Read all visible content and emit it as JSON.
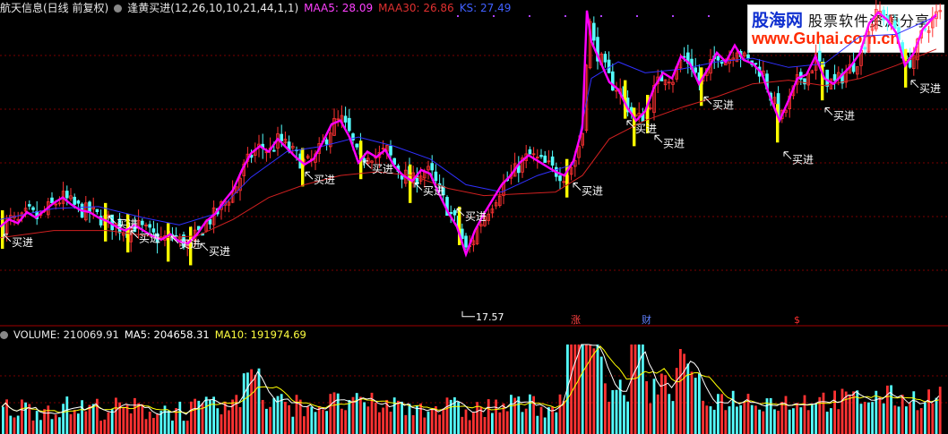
{
  "header": {
    "title": "航天信息(日线 前复权)",
    "indicator": "逢黄买进(12,26,10,10,21,44,1,1)",
    "maa5_label": "MAA5: 28.09",
    "maa30_label": "MAA30: 26.86",
    "ks_label": "KS: 27.49"
  },
  "volume_header": {
    "volume": "VOLUME: 210069.91",
    "ma5": "MA5: 204658.31",
    "ma10": "MA10: 191974.69"
  },
  "logo": {
    "brand": "股海网",
    "tagline": "股票软件资源分享",
    "url": "www.Guhai.com.cn"
  },
  "chart_data": {
    "type": "candlestick",
    "title": "航天信息(日线 前复权)",
    "low_marker": "17.57",
    "signal_label": "买进",
    "event_labels": [
      "涨",
      "财",
      "$"
    ],
    "y_range": [
      16.5,
      33.2
    ],
    "colors": {
      "up": "#ff3232",
      "down": "#54ffff",
      "yellow_bar": "#ffff00",
      "maa5": "#ff00ff",
      "maa30": "#d02020",
      "ks": "#3030ff",
      "signal_text": "#ffffff",
      "volume_ma5": "#ffffff",
      "volume_ma10": "#ffff00",
      "grid": "#7a0000"
    },
    "price_path": [
      [
        0,
        21.8
      ],
      [
        10,
        22.2
      ],
      [
        20,
        22.0
      ],
      [
        30,
        22.6
      ],
      [
        40,
        22.3
      ],
      [
        50,
        22.7
      ],
      [
        60,
        23.1
      ],
      [
        70,
        23.4
      ],
      [
        80,
        23.0
      ],
      [
        90,
        22.7
      ],
      [
        100,
        22.6
      ],
      [
        110,
        22.3
      ],
      [
        120,
        22.1
      ],
      [
        130,
        21.8
      ],
      [
        140,
        21.6
      ],
      [
        150,
        21.9
      ],
      [
        160,
        21.6
      ],
      [
        170,
        21.3
      ],
      [
        180,
        21.1
      ],
      [
        190,
        21.4
      ],
      [
        200,
        21.0
      ],
      [
        210,
        20.9
      ],
      [
        220,
        21.4
      ],
      [
        230,
        22.1
      ],
      [
        240,
        22.5
      ],
      [
        250,
        23.2
      ],
      [
        260,
        23.8
      ],
      [
        270,
        24.9
      ],
      [
        280,
        25.8
      ],
      [
        290,
        26.2
      ],
      [
        300,
        25.9
      ],
      [
        310,
        26.6
      ],
      [
        320,
        26.1
      ],
      [
        330,
        25.6
      ],
      [
        340,
        25.2
      ],
      [
        350,
        25.5
      ],
      [
        360,
        26.4
      ],
      [
        370,
        27.4
      ],
      [
        380,
        27.6
      ],
      [
        390,
        26.7
      ],
      [
        400,
        25.3
      ],
      [
        410,
        25.9
      ],
      [
        420,
        25.6
      ],
      [
        430,
        26.0
      ],
      [
        440,
        25.1
      ],
      [
        450,
        24.6
      ],
      [
        460,
        24.3
      ],
      [
        470,
        24.9
      ],
      [
        480,
        24.7
      ],
      [
        490,
        23.6
      ],
      [
        500,
        22.6
      ],
      [
        510,
        21.8
      ],
      [
        520,
        20.3
      ],
      [
        530,
        21.6
      ],
      [
        540,
        22.5
      ],
      [
        550,
        23.3
      ],
      [
        560,
        24.1
      ],
      [
        570,
        24.6
      ],
      [
        580,
        25.3
      ],
      [
        590,
        25.7
      ],
      [
        600,
        25.4
      ],
      [
        610,
        25.1
      ],
      [
        620,
        24.8
      ],
      [
        630,
        24.6
      ],
      [
        640,
        25.4
      ],
      [
        650,
        27.2
      ],
      [
        655,
        33.6
      ],
      [
        660,
        31.9
      ],
      [
        670,
        30.8
      ],
      [
        680,
        29.7
      ],
      [
        690,
        29.3
      ],
      [
        700,
        28.3
      ],
      [
        710,
        27.6
      ],
      [
        720,
        28.1
      ],
      [
        730,
        29.4
      ],
      [
        740,
        30.2
      ],
      [
        750,
        29.9
      ],
      [
        760,
        31.1
      ],
      [
        770,
        30.7
      ],
      [
        780,
        29.6
      ],
      [
        790,
        30.4
      ],
      [
        800,
        31.3
      ],
      [
        810,
        30.8
      ],
      [
        820,
        31.7
      ],
      [
        830,
        30.9
      ],
      [
        840,
        30.7
      ],
      [
        850,
        30.2
      ],
      [
        860,
        28.8
      ],
      [
        870,
        27.6
      ],
      [
        880,
        28.7
      ],
      [
        890,
        29.9
      ],
      [
        900,
        30.1
      ],
      [
        910,
        31.1
      ],
      [
        920,
        29.9
      ],
      [
        930,
        29.6
      ],
      [
        940,
        30.1
      ],
      [
        950,
        30.6
      ],
      [
        960,
        31.3
      ],
      [
        970,
        32.9
      ],
      [
        980,
        33.5
      ],
      [
        990,
        33.1
      ],
      [
        1000,
        32.4
      ],
      [
        1010,
        30.6
      ],
      [
        1020,
        31.3
      ],
      [
        1030,
        32.6
      ],
      [
        1045,
        33.4
      ]
    ],
    "ks_line": [
      [
        0,
        22.2
      ],
      [
        60,
        22.8
      ],
      [
        110,
        22.9
      ],
      [
        160,
        22.3
      ],
      [
        200,
        21.9
      ],
      [
        240,
        22.5
      ],
      [
        280,
        24.5
      ],
      [
        320,
        25.9
      ],
      [
        360,
        26.2
      ],
      [
        400,
        26.7
      ],
      [
        440,
        26.2
      ],
      [
        480,
        25.5
      ],
      [
        520,
        24.1
      ],
      [
        560,
        23.7
      ],
      [
        600,
        24.6
      ],
      [
        640,
        25.2
      ],
      [
        660,
        29.9
      ],
      [
        690,
        30.8
      ],
      [
        720,
        30.2
      ],
      [
        760,
        30.4
      ],
      [
        800,
        30.8
      ],
      [
        840,
        31.0
      ],
      [
        880,
        30.5
      ],
      [
        920,
        30.7
      ],
      [
        960,
        32.2
      ],
      [
        1000,
        32.3
      ],
      [
        1045,
        33.3
      ]
    ],
    "maa30_line": [
      [
        0,
        21.2
      ],
      [
        60,
        21.6
      ],
      [
        120,
        21.6
      ],
      [
        180,
        21.2
      ],
      [
        220,
        21.3
      ],
      [
        260,
        22.2
      ],
      [
        300,
        23.4
      ],
      [
        340,
        24.1
      ],
      [
        380,
        24.6
      ],
      [
        420,
        24.8
      ],
      [
        460,
        24.6
      ],
      [
        500,
        23.9
      ],
      [
        540,
        23.5
      ],
      [
        580,
        23.6
      ],
      [
        620,
        23.7
      ],
      [
        650,
        24.6
      ],
      [
        680,
        26.6
      ],
      [
        720,
        27.6
      ],
      [
        760,
        28.3
      ],
      [
        800,
        28.9
      ],
      [
        840,
        29.6
      ],
      [
        880,
        29.8
      ],
      [
        920,
        29.5
      ],
      [
        960,
        29.9
      ],
      [
        1000,
        30.6
      ],
      [
        1045,
        31.5
      ]
    ],
    "yellow_signals": [
      {
        "x": 0,
        "price": 21.8
      },
      {
        "x": 115,
        "price": 22.2
      },
      {
        "x": 140,
        "price": 21.6
      },
      {
        "x": 185,
        "price": 21.1
      },
      {
        "x": 210,
        "price": 20.9
      },
      {
        "x": 335,
        "price": 25.2
      },
      {
        "x": 400,
        "price": 25.6
      },
      {
        "x": 455,
        "price": 24.3
      },
      {
        "x": 510,
        "price": 22.0
      },
      {
        "x": 630,
        "price": 24.6
      },
      {
        "x": 695,
        "price": 28.9
      },
      {
        "x": 705,
        "price": 27.4
      },
      {
        "x": 720,
        "price": 28.1
      },
      {
        "x": 780,
        "price": 29.6
      },
      {
        "x": 865,
        "price": 27.6
      },
      {
        "x": 915,
        "price": 29.9
      },
      {
        "x": 1008,
        "price": 30.6
      }
    ],
    "signal_labels_at": [
      {
        "x": 0,
        "price": 21.0
      },
      {
        "x": 117,
        "price": 22.0
      },
      {
        "x": 142,
        "price": 21.2
      },
      {
        "x": 187,
        "price": 20.9
      },
      {
        "x": 220,
        "price": 20.5
      },
      {
        "x": 337,
        "price": 24.4
      },
      {
        "x": 402,
        "price": 25.0
      },
      {
        "x": 459,
        "price": 23.8
      },
      {
        "x": 506,
        "price": 22.4
      },
      {
        "x": 636,
        "price": 23.8
      },
      {
        "x": 696,
        "price": 27.2
      },
      {
        "x": 727,
        "price": 26.4
      },
      {
        "x": 782,
        "price": 28.5
      },
      {
        "x": 871,
        "price": 25.5
      },
      {
        "x": 917,
        "price": 27.9
      },
      {
        "x": 1013,
        "price": 29.4
      }
    ],
    "volume": {
      "y_range": [
        0,
        330000
      ],
      "last": 210069.91,
      "ma5": 204658.31,
      "ma10": 191974.69,
      "spikes": [
        {
          "x": 640,
          "value": 320000
        },
        {
          "x": 650,
          "value": 340000
        },
        {
          "x": 660,
          "value": 280000
        },
        {
          "x": 280,
          "value": 270000
        },
        {
          "x": 710,
          "value": 300000
        },
        {
          "x": 760,
          "value": 240000
        }
      ]
    }
  }
}
